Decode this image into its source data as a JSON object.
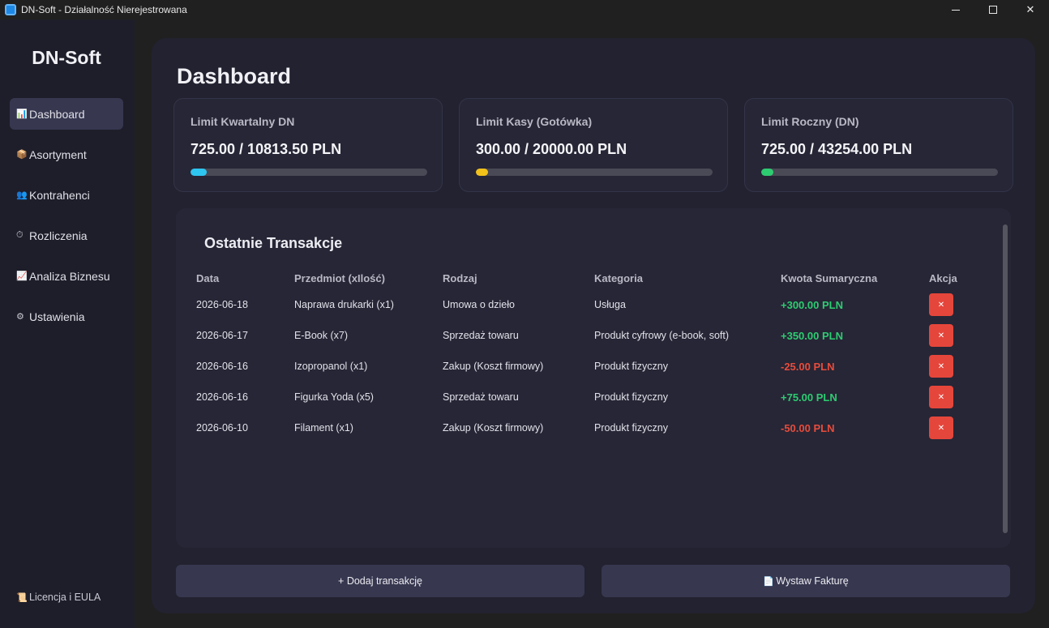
{
  "window": {
    "title": "DN-Soft - Działalność Nierejestrowana",
    "minimize_icon": "minimize-icon",
    "maximize_icon": "maximize-icon",
    "close_glyph": "✕"
  },
  "sidebar": {
    "brand": "DN-Soft",
    "items": [
      {
        "icon": "📊",
        "label": "Dashboard",
        "active": true
      },
      {
        "icon": "📦",
        "label": "Asortyment"
      },
      {
        "icon": "👥",
        "label": "Kontrahenci"
      },
      {
        "icon": "⏱",
        "label": "Rozliczenia"
      },
      {
        "icon": "📈",
        "label": "Analiza Biznesu"
      },
      {
        "icon": "⚙",
        "label": "Ustawienia"
      }
    ],
    "license": {
      "icon": "📜",
      "label": "Licencja i EULA"
    }
  },
  "main": {
    "title": "Dashboard",
    "cards": [
      {
        "title": "Limit Kwartalny DN",
        "value": "725.00 / 10813.50 PLN",
        "progress": 0.067,
        "color": "#2ec5f0"
      },
      {
        "title": "Limit Kasy (Gotówka)",
        "value": "300.00 / 20000.00 PLN",
        "progress": 0.015,
        "color": "#f2c21b"
      },
      {
        "title": "Limit Roczny (DN)",
        "value": "725.00 / 43254.00 PLN",
        "progress": 0.017,
        "color": "#2ecc71"
      }
    ],
    "transactions": {
      "title": "Ostatnie Transakcje",
      "headers": [
        "Data",
        "Przedmiot (xIlość)",
        "Rodzaj",
        "Kategoria",
        "Kwota Sumaryczna",
        "Akcja"
      ],
      "delete_glyph": "✕",
      "rows": [
        {
          "date": "2026-06-18",
          "item": "Naprawa drukarki (x1)",
          "type": "Umowa o dzieło",
          "category": "Usługa",
          "amount": "+300.00 PLN",
          "positive": true
        },
        {
          "date": "2026-06-17",
          "item": "E-Book (x7)",
          "type": "Sprzedaż towaru",
          "category": "Produkt cyfrowy (e-book, soft)",
          "amount": "+350.00 PLN",
          "positive": true
        },
        {
          "date": "2026-06-16",
          "item": "Izopropanol (x1)",
          "type": "Zakup (Koszt firmowy)",
          "category": "Produkt fizyczny",
          "amount": "-25.00 PLN",
          "positive": false
        },
        {
          "date": "2026-06-16",
          "item": "Figurka Yoda (x5)",
          "type": "Sprzedaż towaru",
          "category": "Produkt fizyczny",
          "amount": "+75.00 PLN",
          "positive": true
        },
        {
          "date": "2026-06-10",
          "item": "Filament (x1)",
          "type": "Zakup (Koszt firmowy)",
          "category": "Produkt fizyczny",
          "amount": "-50.00 PLN",
          "positive": false
        }
      ]
    },
    "buttons": {
      "add": "+ Dodaj transakcję",
      "invoice": "Wystaw Fakturę",
      "invoice_icon": "📄"
    }
  },
  "colors": {
    "positive": "#2ecc71",
    "negative": "#e74c3c",
    "accent": "#373750"
  }
}
